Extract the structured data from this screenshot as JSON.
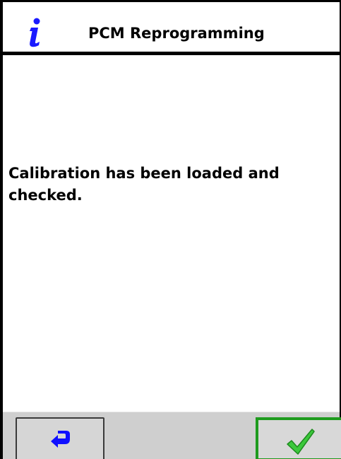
{
  "header": {
    "title": "PCM Reprogramming",
    "icon": "info-icon"
  },
  "main": {
    "message": "Calibration has been loaded and checked."
  },
  "footer": {
    "back_button": {
      "icon": "back-arrow-icon"
    },
    "ok_button": {
      "icon": "checkmark-icon"
    }
  },
  "colors": {
    "info_icon": "#1a1aff",
    "back_arrow": "#1010ff",
    "ok_border": "#1e9b1e",
    "checkmark": "#3cc83c",
    "footer_bg": "#cfcfcf"
  }
}
